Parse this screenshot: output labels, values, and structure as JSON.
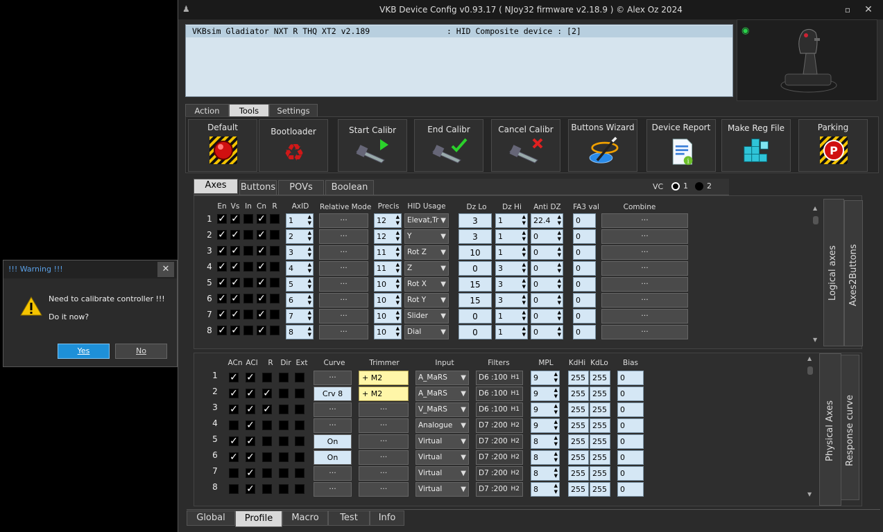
{
  "window": {
    "title": "VKB Device Config v0.93.17 ( NJoy32 firmware v2.18.9 ) © Alex Oz 2024",
    "min": "▫",
    "close": "✕"
  },
  "device": {
    "row": "VKBsim Gladiator NXT R THQ XT2 v2.189                : HID Composite device : [2]"
  },
  "main_tabs": [
    "Action",
    "Tools",
    "Settings"
  ],
  "tools": [
    {
      "label": "Default",
      "icon": "default-red-button-icon"
    },
    {
      "label": "Bootloader",
      "icon": "recycle-icon"
    },
    {
      "label": "Start Calibr",
      "icon": "caliper-play-icon"
    },
    {
      "label": "End Calibr",
      "icon": "caliper-check-icon"
    },
    {
      "label": "Cancel Calibr",
      "icon": "caliper-cancel-icon"
    },
    {
      "label": "Buttons Wizard",
      "icon": "wizard-icon"
    },
    {
      "label": "Device Report",
      "icon": "report-icon"
    },
    {
      "label": "Make Reg File",
      "icon": "reg-cube-icon"
    },
    {
      "label": "Parking",
      "icon": "parking-icon"
    }
  ],
  "profile_tabs": [
    "Axes",
    "Buttons",
    "POVs",
    "Boolean"
  ],
  "vc": {
    "label": "VC",
    "opt1": "1",
    "opt2": "2"
  },
  "logical": {
    "headers": {
      "en": "En",
      "vs": "Vs",
      "in": "In",
      "cn": "Cn",
      "r": "R",
      "axid": "AxID",
      "rel": "Relative Mode",
      "precis": "Precis",
      "hid": "HID Usage",
      "dzlo": "Dz Lo",
      "dzhi": "Dz Hi",
      "anti": "Anti DZ",
      "fa3": "FA3 val",
      "combine": "Combine"
    },
    "rows": [
      {
        "n": "1",
        "en": true,
        "vs": true,
        "in": false,
        "cn": true,
        "r": false,
        "axid": "1",
        "rel": "···",
        "precis": "12",
        "hid": "Elevat,Tr",
        "dzlo": "3",
        "dzhi": "1",
        "anti": "22.4",
        "fa3": "0",
        "combine": "···"
      },
      {
        "n": "2",
        "en": true,
        "vs": true,
        "in": false,
        "cn": true,
        "r": false,
        "axid": "2",
        "rel": "···",
        "precis": "12",
        "hid": "Y",
        "dzlo": "3",
        "dzhi": "1",
        "anti": "0",
        "fa3": "0",
        "combine": "···"
      },
      {
        "n": "3",
        "en": true,
        "vs": true,
        "in": false,
        "cn": true,
        "r": false,
        "axid": "3",
        "rel": "···",
        "precis": "11",
        "hid": "Rot Z",
        "dzlo": "10",
        "dzhi": "1",
        "anti": "0",
        "fa3": "0",
        "combine": "···"
      },
      {
        "n": "4",
        "en": true,
        "vs": true,
        "in": false,
        "cn": true,
        "r": false,
        "axid": "4",
        "rel": "···",
        "precis": "11",
        "hid": "Z",
        "dzlo": "0",
        "dzhi": "3",
        "anti": "0",
        "fa3": "0",
        "combine": "···"
      },
      {
        "n": "5",
        "en": true,
        "vs": true,
        "in": false,
        "cn": true,
        "r": false,
        "axid": "5",
        "rel": "···",
        "precis": "10",
        "hid": "Rot X",
        "dzlo": "15",
        "dzhi": "3",
        "anti": "0",
        "fa3": "0",
        "combine": "···"
      },
      {
        "n": "6",
        "en": true,
        "vs": true,
        "in": false,
        "cn": true,
        "r": false,
        "axid": "6",
        "rel": "···",
        "precis": "10",
        "hid": "Rot Y",
        "dzlo": "15",
        "dzhi": "3",
        "anti": "0",
        "fa3": "0",
        "combine": "···"
      },
      {
        "n": "7",
        "en": true,
        "vs": true,
        "in": false,
        "cn": true,
        "r": false,
        "axid": "7",
        "rel": "···",
        "precis": "10",
        "hid": "Slider",
        "dzlo": "0",
        "dzhi": "1",
        "anti": "0",
        "fa3": "0",
        "combine": "···"
      },
      {
        "n": "8",
        "en": true,
        "vs": true,
        "in": false,
        "cn": true,
        "r": false,
        "axid": "8",
        "rel": "···",
        "precis": "10",
        "hid": "Dial",
        "dzlo": "0",
        "dzhi": "1",
        "anti": "0",
        "fa3": "0",
        "combine": "···"
      }
    ],
    "side1": "Logical axes",
    "side2": "Axes2Buttons"
  },
  "physical": {
    "headers": {
      "acn": "ACn",
      "acl": "ACl",
      "r": "R",
      "dir": "Dir",
      "ext": "Ext",
      "curve": "Curve",
      "trimmer": "Trimmer",
      "input": "Input",
      "filters": "Filters",
      "mpl": "MPL",
      "kdhi": "KdHi",
      "kdlo": "KdLo",
      "bias": "Bias"
    },
    "rows": [
      {
        "n": "1",
        "acn": true,
        "acl": true,
        "r": false,
        "dir": false,
        "ext": false,
        "curve": "···",
        "trim": "+   M2",
        "trimOn": true,
        "input": "A_MaRS",
        "f1": "D6 :100",
        "f2": "H1",
        "mpl": "9",
        "kdhi": "255",
        "kdlo": "255",
        "bias": "0"
      },
      {
        "n": "2",
        "acn": true,
        "acl": true,
        "r": true,
        "dir": false,
        "ext": false,
        "curve": "Crv 8",
        "trim": "+   M2",
        "trimOn": true,
        "input": "A_MaRS",
        "f1": "D6 :100",
        "f2": "H1",
        "mpl": "9",
        "kdhi": "255",
        "kdlo": "255",
        "bias": "0"
      },
      {
        "n": "3",
        "acn": true,
        "acl": true,
        "r": true,
        "dir": false,
        "ext": false,
        "curve": "···",
        "trim": "···",
        "trimOn": false,
        "input": "V_MaRS",
        "f1": "D6 :100",
        "f2": "H1",
        "mpl": "9",
        "kdhi": "255",
        "kdlo": "255",
        "bias": "0"
      },
      {
        "n": "4",
        "acn": false,
        "acl": true,
        "r": false,
        "dir": false,
        "ext": false,
        "curve": "···",
        "trim": "···",
        "trimOn": false,
        "input": "Analogue",
        "f1": "D7 :200",
        "f2": "H2",
        "mpl": "9",
        "kdhi": "255",
        "kdlo": "255",
        "bias": "0"
      },
      {
        "n": "5",
        "acn": true,
        "acl": true,
        "r": false,
        "dir": false,
        "ext": false,
        "curve": "On",
        "trim": "···",
        "trimOn": false,
        "input": "Virtual",
        "f1": "D7 :200",
        "f2": "H2",
        "mpl": "8",
        "kdhi": "255",
        "kdlo": "255",
        "bias": "0"
      },
      {
        "n": "6",
        "acn": true,
        "acl": true,
        "r": false,
        "dir": false,
        "ext": false,
        "curve": "On",
        "trim": "···",
        "trimOn": false,
        "input": "Virtual",
        "f1": "D7 :200",
        "f2": "H2",
        "mpl": "8",
        "kdhi": "255",
        "kdlo": "255",
        "bias": "0"
      },
      {
        "n": "7",
        "acn": false,
        "acl": true,
        "r": false,
        "dir": false,
        "ext": false,
        "curve": "···",
        "trim": "···",
        "trimOn": false,
        "input": "Virtual",
        "f1": "D7 :200",
        "f2": "H2",
        "mpl": "8",
        "kdhi": "255",
        "kdlo": "255",
        "bias": "0"
      },
      {
        "n": "8",
        "acn": false,
        "acl": true,
        "r": false,
        "dir": false,
        "ext": false,
        "curve": "···",
        "trim": "···",
        "trimOn": false,
        "input": "Virtual",
        "f1": "D7 :200",
        "f2": "H2",
        "mpl": "8",
        "kdhi": "255",
        "kdlo": "255",
        "bias": "0"
      }
    ],
    "side1": "Physical Axes",
    "side2": "Response curve"
  },
  "bottom_tabs": [
    "Global",
    "Profile",
    "Macro",
    "Test",
    "Info"
  ],
  "warning": {
    "title": "!!! Warning !!!",
    "line1": "Need to calibrate controller !!!",
    "line2": "Do it now?",
    "yes": "Yes",
    "no": "No",
    "close": "✕"
  },
  "colors": {
    "accent": "#1e90d8",
    "field": "#d5e7f5",
    "trimmer": "#fff6a8"
  }
}
